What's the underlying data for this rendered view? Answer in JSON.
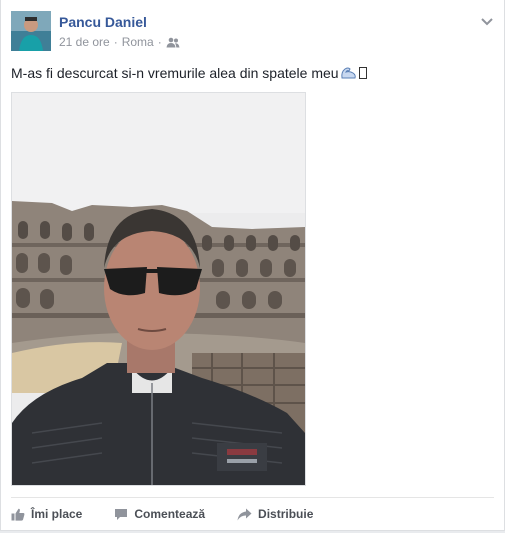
{
  "post": {
    "author": "Pancu Daniel",
    "time": "21 de ore",
    "separator": "·",
    "location": "Roma",
    "privacy_icon": "friends-icon",
    "text": "M-as fi descurcat si-n vremurile alea din spatele meu",
    "text_emoji_icon": "flexed-biceps-icon",
    "photo_description_icon": "photo"
  },
  "actions": {
    "like": "Îmi place",
    "comment": "Comentează",
    "share": "Distribuie"
  },
  "colors": {
    "link": "#365899",
    "meta": "#90949c",
    "action": "#4b4f56"
  }
}
